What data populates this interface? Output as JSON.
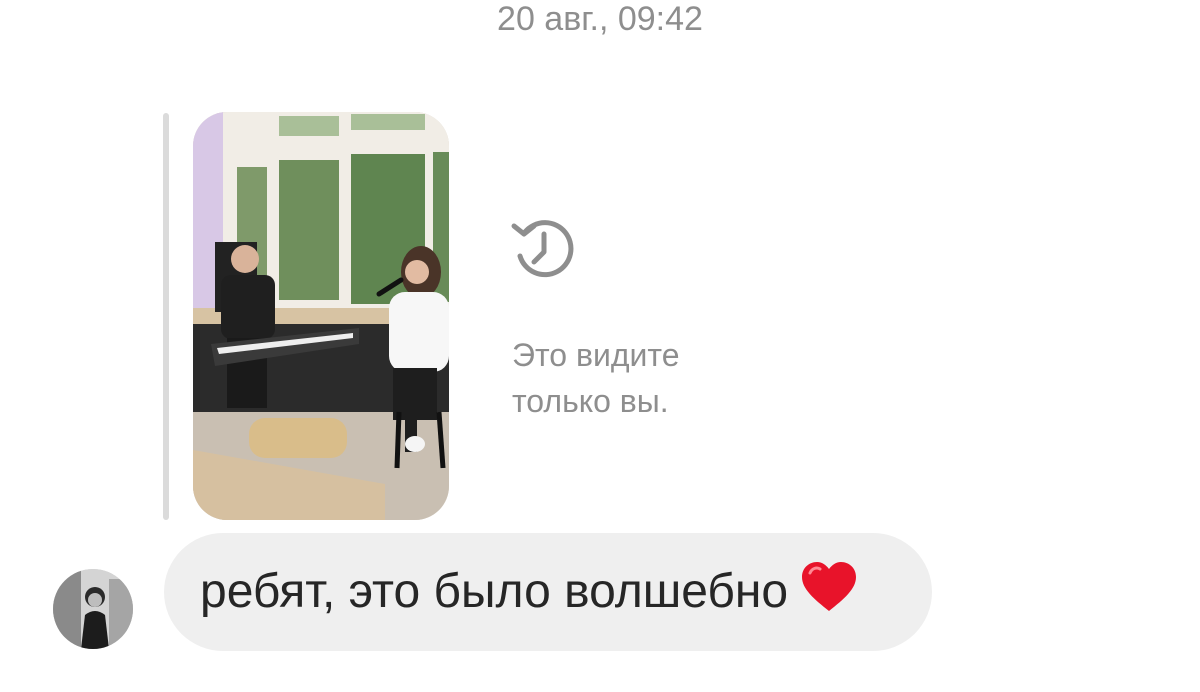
{
  "header": {
    "timestamp": "20 авг., 09:42"
  },
  "story_reply": {
    "expired_icon": "history-icon",
    "expired_text_line1": "Это видите",
    "expired_text_line2": "только вы."
  },
  "message": {
    "text": "ребят, это было волшебно",
    "emoji_icon": "red-heart-icon",
    "bubble_color": "#efefef"
  },
  "colors": {
    "muted_text": "#8e8e8e",
    "message_text": "#262626",
    "heart": "#e8132a"
  }
}
